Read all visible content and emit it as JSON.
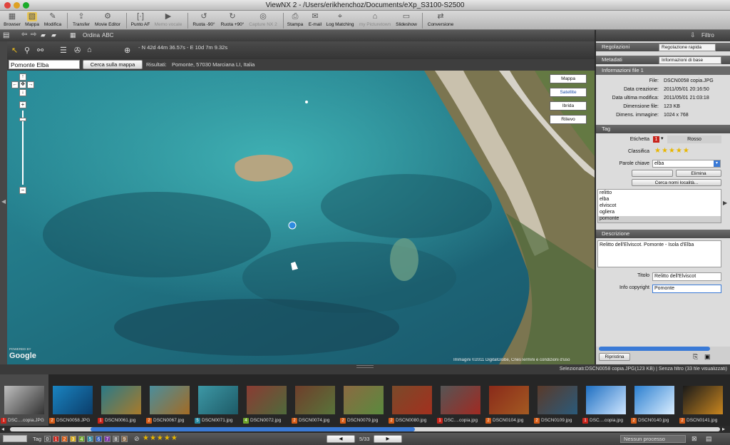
{
  "window": {
    "title": "ViewNX 2 - /Users/erikhenchoz/Documents/eXp_S3100-S2500"
  },
  "toolbar": {
    "items": [
      {
        "label": "Browser",
        "icon": "browser-icon"
      },
      {
        "label": "Mappa",
        "icon": "map-icon"
      },
      {
        "label": "Modifica",
        "icon": "edit-icon"
      },
      {
        "label": "Transfer",
        "icon": "transfer-icon"
      },
      {
        "label": "Movie Editor",
        "icon": "movie-editor-icon"
      },
      {
        "label": "Punto AF",
        "icon": "af-point-icon"
      },
      {
        "label": "Memo vocale",
        "icon": "voice-memo-icon"
      },
      {
        "label": "Ruota -90°",
        "icon": "rotate-left-icon"
      },
      {
        "label": "Ruota +90°",
        "icon": "rotate-right-icon"
      },
      {
        "label": "Capture NX 2",
        "icon": "capture-nx-icon"
      },
      {
        "label": "Stampa",
        "icon": "print-icon"
      },
      {
        "label": "E-mail",
        "icon": "email-icon"
      },
      {
        "label": "Log Matching",
        "icon": "log-matching-icon"
      },
      {
        "label": "my Picturetown",
        "icon": "picturetown-icon"
      },
      {
        "label": "Slideshow",
        "icon": "slideshow-icon"
      },
      {
        "label": "Conversione",
        "icon": "conversion-icon"
      }
    ]
  },
  "subtoolbar": {
    "sort_label": "Ordina",
    "sort_value": "ABC",
    "filter_label": "Filtro"
  },
  "maptools": {
    "coords": "- N 42d 44m 36.57s - E 10d 7m 9.32s"
  },
  "mapsearch": {
    "query": "Pomonte Elba",
    "button": "Cerca sulla mappa",
    "results_label": "Risultati:",
    "results_value": "Pomonte, 57030 Marciana LI, Italia"
  },
  "map": {
    "type_buttons": [
      "Mappa",
      "Satellite",
      "Ibrida",
      "Rilievo"
    ],
    "active_type": "Satellite",
    "credit": "Immagini ©2011 DigitalGlobe, Cnes/Spot Image",
    "terms": "Termini e condizioni d'uso",
    "logo": "Google",
    "logo_small": "POWERED BY"
  },
  "panel": {
    "regolazioni": {
      "title": "Regolazioni",
      "dropdown": "Regolazione rapida"
    },
    "metadati": {
      "title": "Metadati",
      "dropdown": "Informazioni di base"
    },
    "fileinfo": {
      "title": "Informazioni file 1",
      "rows": [
        {
          "label": "File:",
          "value": "DSCN0058 copia.JPG"
        },
        {
          "label": "Data creazione:",
          "value": "2011/05/01 20:16:50"
        },
        {
          "label": "Data ultima modifica:",
          "value": "2011/05/01 21:03:18"
        },
        {
          "label": "Dimensione file:",
          "value": "123 KB"
        },
        {
          "label": "Dimens. immagine:",
          "value": "1024 x 768"
        }
      ]
    },
    "tag": {
      "title": "Tag",
      "label_label": "Etichetta",
      "label_number": "1",
      "label_value": "Rosso",
      "rating_label": "Classifica",
      "rating": 5,
      "keywords_label": "Parole chiave",
      "keyword_input": "elba",
      "delete_button": "Elimina",
      "search_button": "Cerca nomi località...",
      "keywords": [
        "relitto",
        "elba",
        "elviscot",
        "ogliera",
        "pomonte"
      ],
      "selected_keyword": "pomonte"
    },
    "description": {
      "title": "Descrizione",
      "text": "Relitto dell'Elviscot. Pomonte - Isola d'Elba",
      "title_label": "Titolo",
      "title_value": "Relitto dell'Elviscot",
      "copyright_label": "Info copyright",
      "copyright_value": "Pomonte"
    },
    "reset_button": "Ripristina"
  },
  "status": {
    "text": "Selezionati:DSCN0058 copia.JPG(123 KB) | Senza filtro (33 file visualizzati)"
  },
  "filmstrip": [
    {
      "label": "DSC....copia.JPG",
      "tag": "1",
      "tagcolor": "#c8241b",
      "c1": "#bfbfbf",
      "c2": "#333"
    },
    {
      "label": "DSCN0058.JPG",
      "tag": "2",
      "tagcolor": "#d65c17",
      "c1": "#1a84c1",
      "c2": "#0b3d6a"
    },
    {
      "label": "DSCN0061.jpg",
      "tag": "1",
      "tagcolor": "#c8241b",
      "c1": "#2a7a88",
      "c2": "#a87a2a"
    },
    {
      "label": "DSCN0067.jpg",
      "tag": "2",
      "tagcolor": "#d65c17",
      "c1": "#4b8e9c",
      "c2": "#a36b24"
    },
    {
      "label": "DSCN0071.jpg",
      "tag": "5",
      "tagcolor": "#2a8aa0",
      "c1": "#3d98a6",
      "c2": "#1d5a66"
    },
    {
      "label": "DSCN0072.jpg",
      "tag": "4",
      "tagcolor": "#6fa32b",
      "c1": "#8a3b33",
      "c2": "#4f6a3b"
    },
    {
      "label": "DSCN0074.jpg",
      "tag": "2",
      "tagcolor": "#d65c17",
      "c1": "#6f3e2b",
      "c2": "#58743a"
    },
    {
      "label": "DSCN0079.jpg",
      "tag": "2",
      "tagcolor": "#d65c17",
      "c1": "#8b6a42",
      "c2": "#5a8a3e"
    },
    {
      "label": "DSCN0080.jpg",
      "tag": "2",
      "tagcolor": "#d65c17",
      "c1": "#7a4a2a",
      "c2": "#a3301e"
    },
    {
      "label": "DSC....copia.jpg",
      "tag": "1",
      "tagcolor": "#c8241b",
      "c1": "#555",
      "c2": "#a02a22"
    },
    {
      "label": "DSCN0104.jpg",
      "tag": "2",
      "tagcolor": "#d65c17",
      "c1": "#8a2a1a",
      "c2": "#a35a22"
    },
    {
      "label": "DSCN0109.jpg",
      "tag": "2",
      "tagcolor": "#d65c17",
      "c1": "#5a3a2a",
      "c2": "#2a5a7a"
    },
    {
      "label": "DSC....copia.jpg",
      "tag": "1",
      "tagcolor": "#c8241b",
      "c1": "#1e6fc2",
      "c2": "#cfe6ff"
    },
    {
      "label": "DSCN0140.jpg",
      "tag": "2",
      "tagcolor": "#d65c17",
      "c1": "#2b7fd0",
      "c2": "#dbeeff"
    },
    {
      "label": "DSCN0141.jpg",
      "tag": "2",
      "tagcolor": "#d65c17",
      "c1": "#1a1a1a",
      "c2": "#c9861f"
    }
  ],
  "bottombar": {
    "tag_label": "Tag",
    "tags": [
      "0",
      "1",
      "2",
      "3",
      "4",
      "5",
      "6",
      "7",
      "8",
      "9"
    ],
    "page": "5/33",
    "process": "Nessun processo"
  },
  "colors": {
    "accent": "#3a7ad6",
    "panel": "#dcdcdc",
    "dark": "#3a3a3a"
  }
}
